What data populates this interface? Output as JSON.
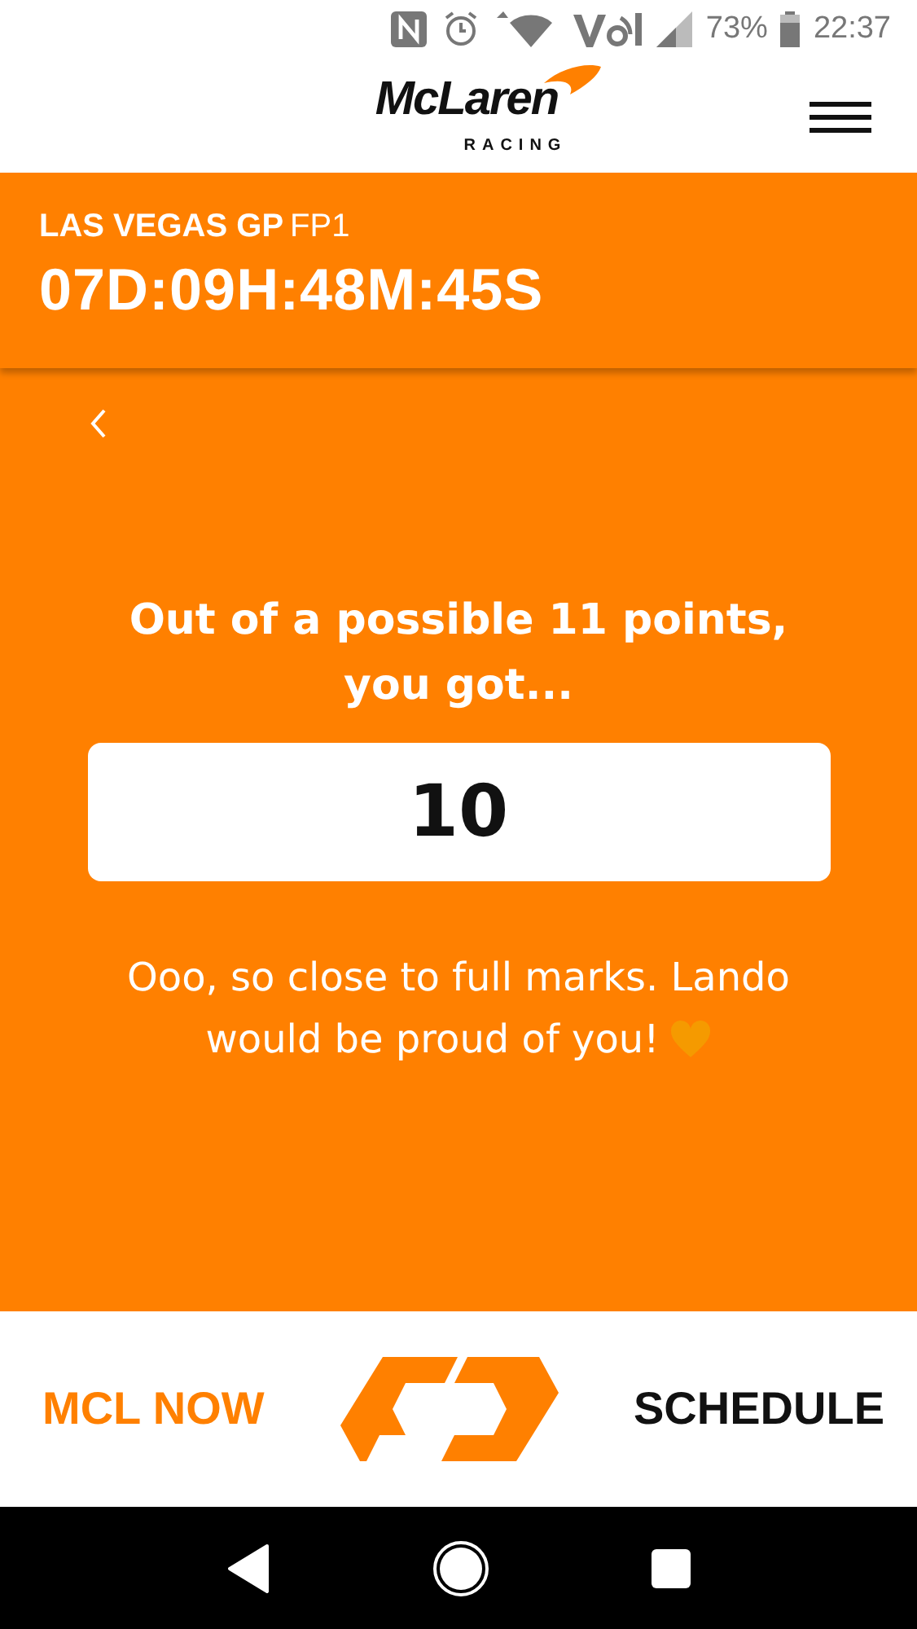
{
  "status_bar": {
    "battery": "73%",
    "time": "22:37"
  },
  "header": {
    "logo": "McLaren",
    "logo_sub": "RACING"
  },
  "event": {
    "name": "LAS VEGAS GP",
    "session": "FP1",
    "countdown": "07D:09H:48M:45S"
  },
  "result": {
    "question": "Out of a possible 11 points, you got...",
    "score": "10",
    "message_lines": [
      "Ooo, so close to full marks. Lando",
      "would be proud of you!"
    ]
  },
  "bottom_bar": {
    "left": "MCL NOW",
    "right": "SCHEDULE"
  }
}
